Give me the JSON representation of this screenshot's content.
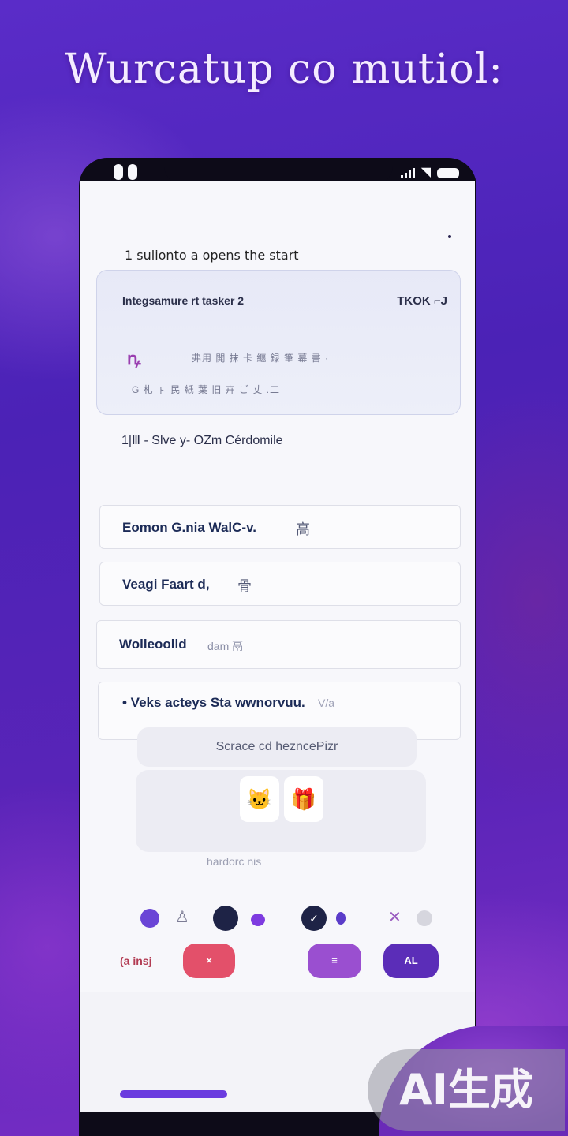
{
  "headline": "Wurcatup co mutiol:",
  "status_bar": {
    "icons": [
      "signal-icon",
      "wifi-icon",
      "battery-icon"
    ]
  },
  "section_title": "1 sulionto a opens the start",
  "card": {
    "title": "Integsamure rt tasker 2",
    "action": "TKOK ⌐J",
    "glyph": "ꝴ",
    "line1": "弗用 開 抹 卡 纏 録 筆 幕 書 ·",
    "line2": "G 札 ㇳ 民 紙 葉 旧 卉 ご 丈 .二"
  },
  "plain_row": "1|Ⅲ - Slve y- OZm Cérdomile",
  "list_items": [
    {
      "label": "Eomon G.nia WalC-v.",
      "glyph": "⾼"
    },
    {
      "label": "Veagi Faart d,",
      "glyph": "⾻"
    },
    {
      "label": "Wolleoolld",
      "extra": "dam 鬲"
    },
    {
      "label": "• Veks acteys Sta wwnorvuu.",
      "extra": "V/a"
    }
  ],
  "sub_label": "hardorc nis",
  "pill_label": "Scrace cd hezncePizr",
  "thumb_icons": [
    "cat-icon",
    "gift-box-icon"
  ],
  "thumbs": [
    "🐱",
    "🎁"
  ],
  "dots_row": {
    "colors": [
      "#6a45d6",
      "#1e2346",
      "#7e3be0",
      "#1e2346",
      "#5b3cc9"
    ],
    "icons": [
      "person-icon",
      "check-icon",
      "close-icon"
    ],
    "check": "✓",
    "close": "✕",
    "person": "♙"
  },
  "action_label": "(a insj",
  "buttons": [
    {
      "label": "×",
      "color": "#e3506a"
    },
    {
      "label": "≡",
      "color": "#9a4fd0"
    },
    {
      "label": "AL",
      "color": "#5b2db8"
    }
  ],
  "watermark": "AI生成"
}
